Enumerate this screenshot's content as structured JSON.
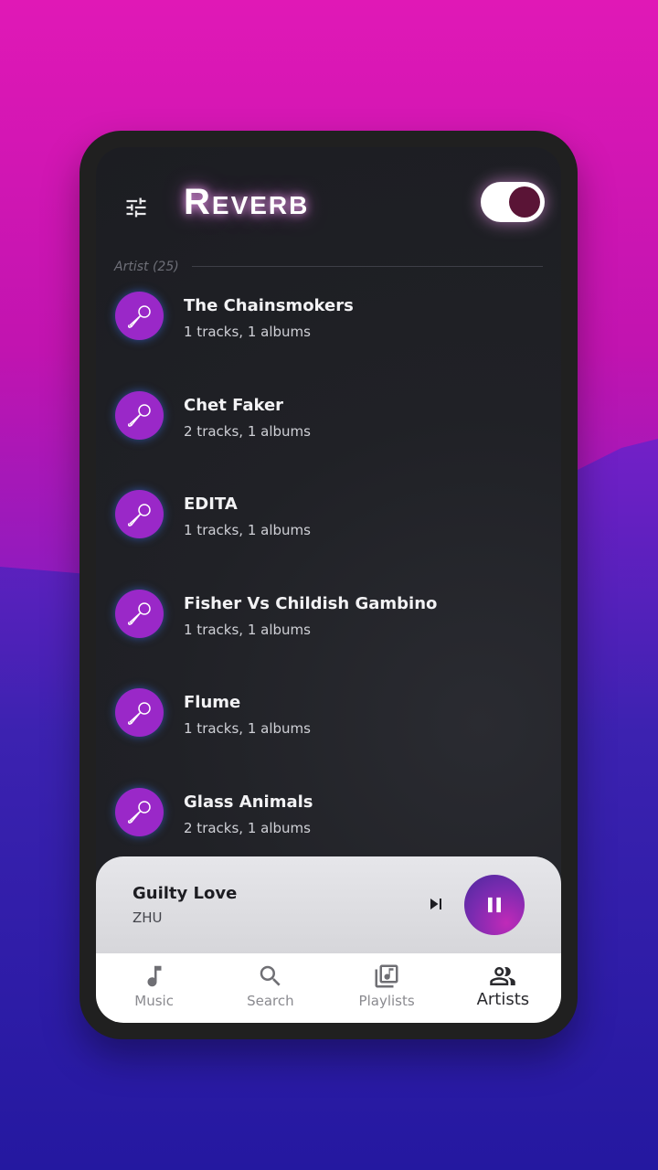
{
  "header": {
    "logo_text": "Reverb",
    "settings_icon": "tune-sliders-icon",
    "theme_toggle_icon": "toggle-switch-icon"
  },
  "section": {
    "label": "Artist (25)"
  },
  "artists": [
    {
      "name": "The Chainsmokers",
      "meta": "1 tracks, 1 albums",
      "icon": "microphone-icon"
    },
    {
      "name": "Chet Faker",
      "meta": "2 tracks, 1 albums",
      "icon": "microphone-icon"
    },
    {
      "name": "EDITA",
      "meta": "1 tracks, 1 albums",
      "icon": "microphone-icon"
    },
    {
      "name": "Fisher Vs Childish Gambino",
      "meta": "1 tracks, 1 albums",
      "icon": "microphone-icon"
    },
    {
      "name": "Flume",
      "meta": "1 tracks, 1 albums",
      "icon": "microphone-icon"
    },
    {
      "name": "Glass Animals",
      "meta": "2 tracks, 1 albums",
      "icon": "microphone-icon"
    }
  ],
  "now_playing": {
    "title": "Guilty Love",
    "artist": "ZHU",
    "next_icon": "skip-next-icon",
    "pause_icon": "pause-icon"
  },
  "nav": {
    "items": [
      {
        "label": "Music",
        "icon": "music-note-icon",
        "active": false
      },
      {
        "label": "Search",
        "icon": "search-icon",
        "active": false
      },
      {
        "label": "Playlists",
        "icon": "library-music-icon",
        "active": false
      },
      {
        "label": "Artists",
        "icon": "people-icon",
        "active": true
      }
    ]
  },
  "colors": {
    "accent": "#9a28c8",
    "screen_bg": "#1e1f24",
    "player_bg": "#dcdce0"
  }
}
